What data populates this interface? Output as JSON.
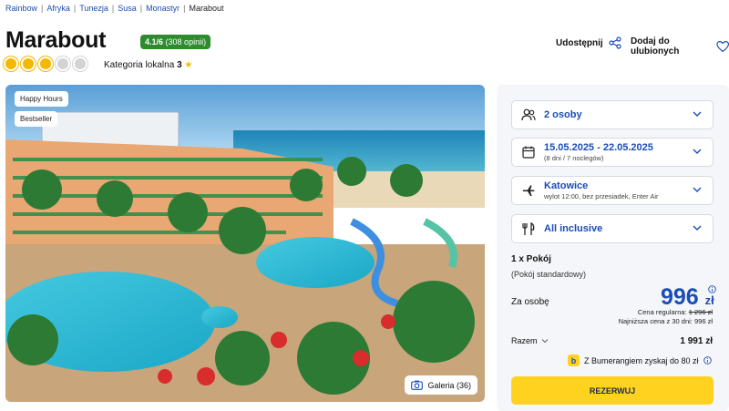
{
  "breadcrumb": [
    {
      "label": "Rainbow"
    },
    {
      "label": "Afryka"
    },
    {
      "label": "Tunezja"
    },
    {
      "label": "Susa"
    },
    {
      "label": "Monastyr"
    },
    {
      "label": "Marabout"
    }
  ],
  "hotel": {
    "name": "Marabout",
    "rating": "4.1/6",
    "reviews": "(308 opinii)",
    "suns_filled": 3,
    "suns_total": 5,
    "category_label": "Kategoria lokalna",
    "category_value": "3"
  },
  "actions": {
    "share": "Udostępnij",
    "favorite": "Dodaj do ulubionych"
  },
  "photo": {
    "tags": [
      "Happy Hours",
      "Bestseller"
    ],
    "gallery": "Galeria (36)"
  },
  "booking": {
    "guests": "2 osoby",
    "dates": "15.05.2025 - 22.05.2025",
    "dates_sub": "(8 dni / 7 noclegów)",
    "departure": "Katowice",
    "departure_sub": "wylot 12:00, bez przesiadek, Enter Air",
    "board": "All inclusive",
    "room_title": "1 x Pokój",
    "room_type": "(Pokój standardowy)",
    "per_person_label": "Za osobę",
    "price": "996",
    "currency": "zł",
    "regular_label": "Cena regularna:",
    "regular_price": "1 296 zł",
    "lowest_label": "Najniższa cena z 30 dni: 996 zł",
    "total_label": "Razem",
    "total_value": "1 991 zł",
    "bumerang": "Z Bumerangiem zyskaj do 80 zł",
    "book_button": "REZERWUJ"
  },
  "colors": {
    "brand_blue": "#1a4db5",
    "book_yellow": "#ffd21f",
    "rating_green": "#2e8b2e",
    "sun_yellow": "#f5b800"
  }
}
